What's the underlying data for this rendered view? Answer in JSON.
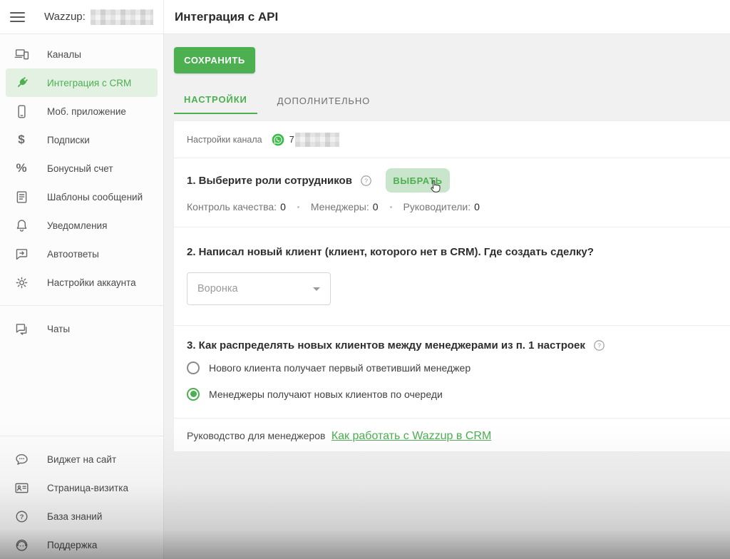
{
  "header": {
    "brand": "Wazzup:",
    "page_title": "Интеграция с API"
  },
  "sidebar": {
    "items": [
      {
        "label": "Каналы",
        "icon": "devices-icon",
        "active": false
      },
      {
        "label": "Интеграция с CRM",
        "icon": "plug-icon",
        "active": true
      },
      {
        "label": "Моб. приложение",
        "icon": "smartphone-icon",
        "active": false
      },
      {
        "label": "Подписки",
        "icon": "dollar-icon",
        "active": false
      },
      {
        "label": "Бонусный счет",
        "icon": "percent-icon",
        "active": false
      },
      {
        "label": "Шаблоны сообщений",
        "icon": "document-icon",
        "active": false
      },
      {
        "label": "Уведомления",
        "icon": "bell-icon",
        "active": false
      },
      {
        "label": "Автоответы",
        "icon": "auto-reply-icon",
        "active": false
      },
      {
        "label": "Настройки аккаунта",
        "icon": "gear-icon",
        "active": false
      },
      {
        "label": "Чаты",
        "icon": "chats-icon",
        "active": false
      }
    ],
    "footer_items": [
      {
        "label": "Виджет на сайт",
        "icon": "widget-bubble-icon"
      },
      {
        "label": "Страница-визитка",
        "icon": "vcard-icon"
      },
      {
        "label": "База знаний",
        "icon": "question-circle-icon"
      },
      {
        "label": "Поддержка",
        "icon": "support-icon"
      }
    ]
  },
  "toolbar": {
    "save_label": "СОХРАНИТЬ"
  },
  "tabs": [
    {
      "label": "НАСТРОЙКИ",
      "active": true
    },
    {
      "label": "ДОПОЛНИТЕЛЬНО",
      "active": false
    }
  ],
  "channel": {
    "label": "Настройки канала",
    "messenger": "whatsapp-icon",
    "phone_prefix": "7"
  },
  "sections": {
    "roles": {
      "title": "1. Выберите роли сотрудников",
      "select_button": "ВЫБРАТЬ",
      "stats": [
        {
          "label": "Контроль качества:",
          "value": "0"
        },
        {
          "label": "Менеджеры:",
          "value": "0"
        },
        {
          "label": "Руководители:",
          "value": "0"
        }
      ]
    },
    "new_client": {
      "title": "2. Написал новый клиент (клиент, которого нет в CRM). Где создать сделку?",
      "dropdown_placeholder": "Воронка"
    },
    "distribution": {
      "title": "3. Как распределять новых клиентов между менеджерами из п. 1 настроек",
      "options": [
        {
          "label": "Нового клиента получает первый ответивший менеджер",
          "selected": false
        },
        {
          "label": "Менеджеры получают новых клиентов по очереди",
          "selected": true
        }
      ]
    },
    "guide": {
      "text": "Руководство для менеджеров",
      "link": "Как работать с Wazzup в CRM"
    }
  },
  "colors": {
    "primary": "#4caf50",
    "active_item_bg": "#e2f1e2",
    "select_button_bg": "#c9e5cb",
    "page_bg": "#f1f1f1",
    "whatsapp_green": "#3cbb49"
  }
}
